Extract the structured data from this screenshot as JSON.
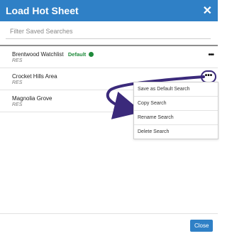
{
  "header": {
    "title": "Load Hot Sheet",
    "close_glyph": "✕"
  },
  "search": {
    "placeholder": "Filter Saved Searches",
    "value": ""
  },
  "saved_searches": [
    {
      "name": "Brentwood Watchlist",
      "subtitle": "RES",
      "default_label": "Default"
    },
    {
      "name": "Crocket Hills Area",
      "subtitle": "RES",
      "default_label": ""
    },
    {
      "name": "Magnolia Grove",
      "subtitle": "RES",
      "default_label": ""
    }
  ],
  "more_glyph": "•••",
  "context_menu": {
    "items": [
      "Save as Default Search",
      "Copy Search",
      "Rename Search",
      "Delete Search"
    ]
  },
  "footer": {
    "close_label": "Close"
  },
  "colors": {
    "header_bg": "#2f80c6",
    "default_badge": "#1f8a3b",
    "annotation_arrow": "#3b2a7b"
  }
}
